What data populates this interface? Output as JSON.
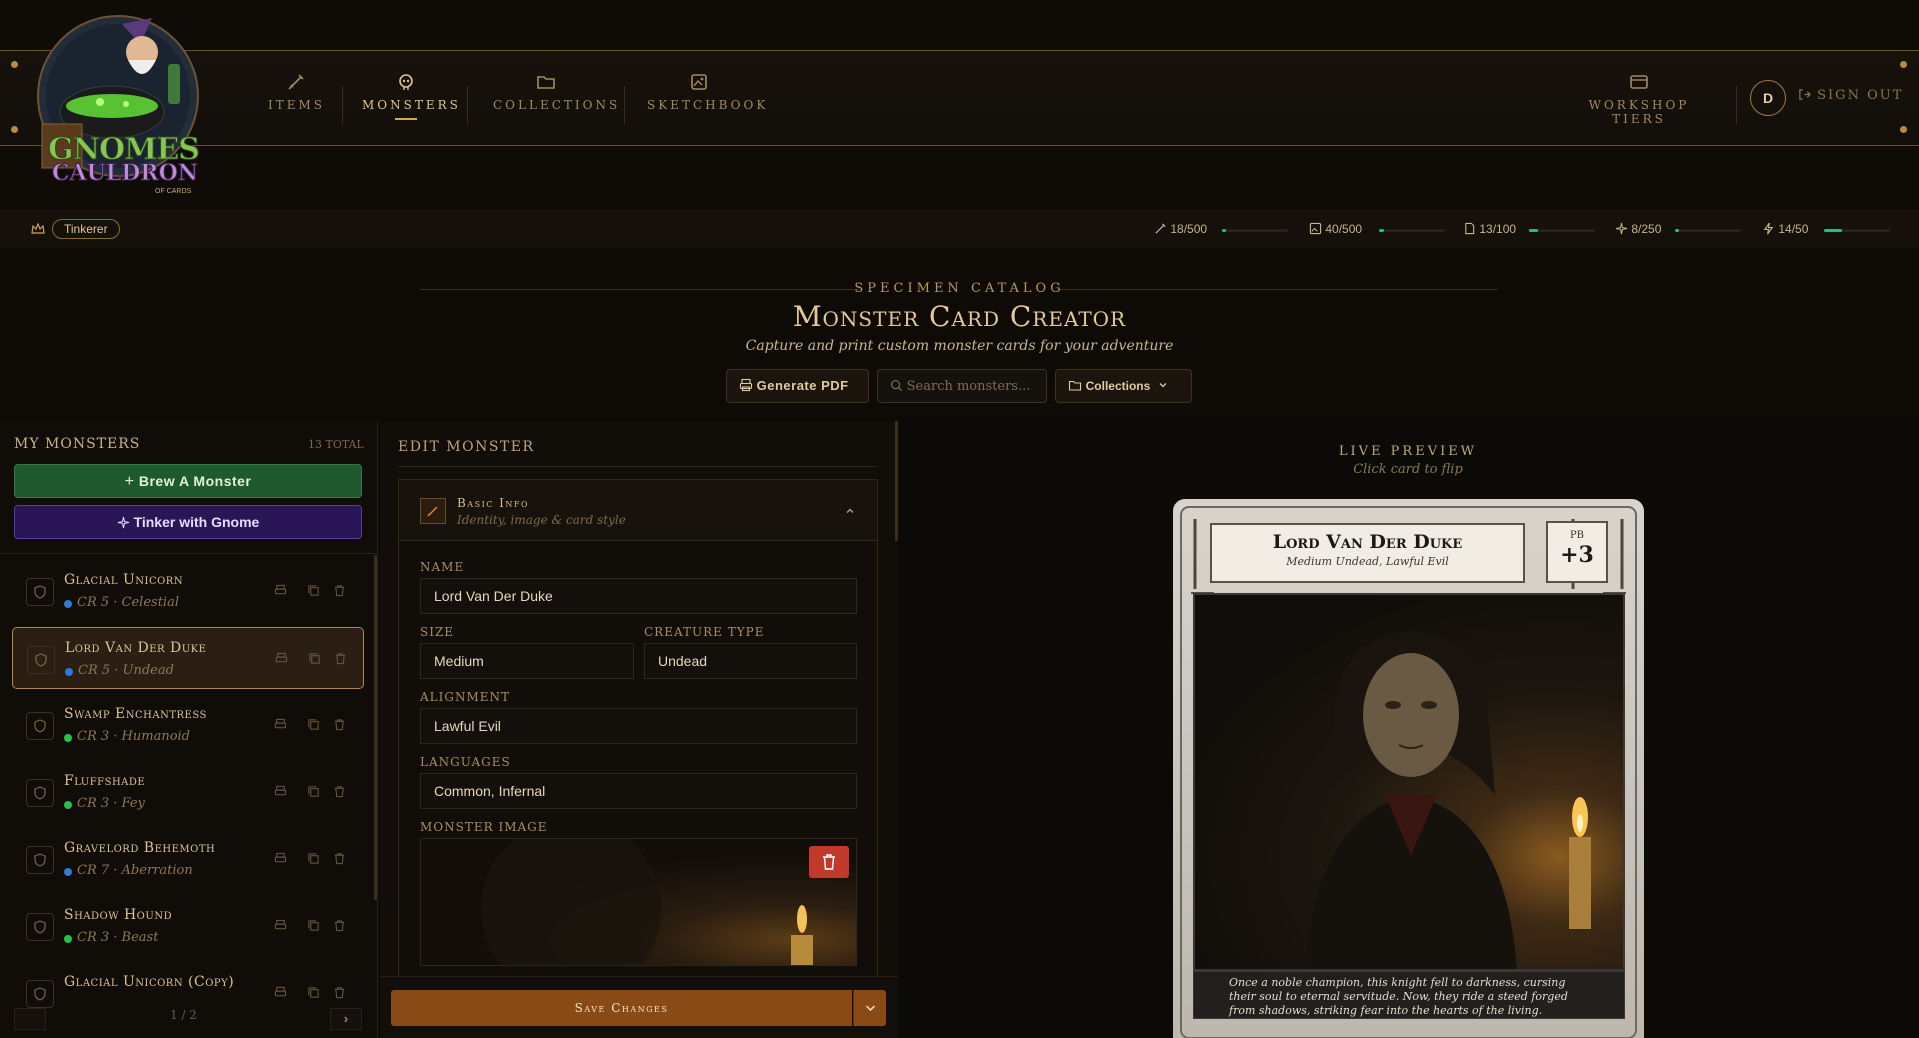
{
  "app": {
    "brand_line1": "GNOMES",
    "brand_line2": "CAULDRON",
    "brand_tagline": "OF CARDS"
  },
  "nav": {
    "items": [
      {
        "label": "ITEMS",
        "icon": "sword-icon",
        "active": false
      },
      {
        "label": "MONSTERS",
        "icon": "skull-icon",
        "active": true
      },
      {
        "label": "COLLECTIONS",
        "icon": "folder-icon",
        "active": false
      },
      {
        "label": "SKETCHBOOK",
        "icon": "image-gallery-icon",
        "active": false
      }
    ],
    "workshop_label": "WORKSHOP TIERS",
    "avatar_initial": "D",
    "signout_label": "SIGN OUT"
  },
  "usage": {
    "tier": "Tinkerer",
    "meters": [
      {
        "icon": "sword-icon",
        "text": "18/500",
        "fraction": 0.036
      },
      {
        "icon": "image-icon",
        "text": "40/500",
        "fraction": 0.08
      },
      {
        "icon": "document-icon",
        "text": "13/100",
        "fraction": 0.13
      },
      {
        "icon": "sparkle-icon",
        "text": "8/250",
        "fraction": 0.032
      },
      {
        "icon": "lightning-icon",
        "text": "14/50",
        "fraction": 0.28
      }
    ]
  },
  "header": {
    "eyebrow": "SPECIMEN CATALOG",
    "title": "Monster Card Creator",
    "subtitle": "Capture and print custom monster cards for your adventure",
    "generate_pdf": "Generate PDF",
    "search_placeholder": "Search monsters...",
    "collections": "Collections"
  },
  "left": {
    "title": "MY MONSTERS",
    "total": "13 TOTAL",
    "brew_label": "Brew A Monster",
    "tinker_label": "Tinker with Gnome",
    "monsters": [
      {
        "name": "Glacial Unicorn",
        "meta": "CR 5 · Celestial",
        "dot": "#2f7bd8"
      },
      {
        "name": "Lord Van Der Duke",
        "meta": "CR 5 · Undead",
        "dot": "#2f7bd8"
      },
      {
        "name": "Swamp Enchantress",
        "meta": "CR 3 · Humanoid",
        "dot": "#27c24a"
      },
      {
        "name": "Fluffshade",
        "meta": "CR 3 · Fey",
        "dot": "#27c24a"
      },
      {
        "name": "Gravelord Behemoth",
        "meta": "CR 7 · Aberration",
        "dot": "#2f7bd8"
      },
      {
        "name": "Shadow Hound",
        "meta": "CR 3 · Beast",
        "dot": "#27c24a"
      },
      {
        "name": "Glacial Unicorn (Copy)",
        "meta": "",
        "dot": ""
      }
    ],
    "pager": "1 / 2"
  },
  "edit": {
    "title": "EDIT MONSTER",
    "section_title": "Basic Info",
    "section_sub": "Identity, image & card style",
    "name_label": "NAME",
    "name_value": "Lord Van Der Duke",
    "size_label": "SIZE",
    "size_value": "Medium",
    "type_label": "CREATURE TYPE",
    "type_value": "Undead",
    "alignment_label": "ALIGNMENT",
    "alignment_value": "Lawful Evil",
    "languages_label": "LANGUAGES",
    "languages_value": "Common, Infernal",
    "image_label": "MONSTER IMAGE",
    "save_label": "Save Changes"
  },
  "preview": {
    "title": "LIVE PREVIEW",
    "sub": "Click card to flip",
    "card_name": "Lord Van Der Duke",
    "card_sub": "Medium Undead, Lawful Evil",
    "pb_label": "PB",
    "pb_value": "+3",
    "flavor": "Once a noble champion, this knight fell to darkness, cursing their soul to eternal servitude. Now, they ride a steed forged from shadows, striking fear into the hearts of the living."
  }
}
